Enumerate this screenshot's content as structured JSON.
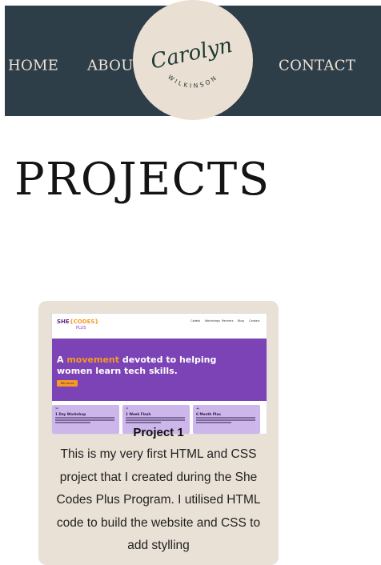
{
  "nav": {
    "items": [
      {
        "label": "HOME"
      },
      {
        "label": "ABOUT"
      },
      {
        "label": "CONTACT"
      }
    ]
  },
  "logo": {
    "script": "Carolyn",
    "surname": "WILKINSON"
  },
  "page_title": "PROJECTS",
  "project_card": {
    "title": "Project 1",
    "description": "This is my very first HTML and CSS project that I created during the She Codes Plus Program. I utilised HTML code to build the website and CSS to add stylling",
    "thumbnail": {
      "brand_she": "SHE",
      "brand_codes": "{CODES}",
      "brand_plus": "PLUS",
      "nav": [
        "Cadets",
        "Workshops",
        "Partners",
        "Blog",
        "Contact"
      ],
      "hero_prefix": "A ",
      "hero_highlight": "movement",
      "hero_suffix": " devoted to helping women learn tech skills.",
      "hero_button": "We count",
      "tiles": [
        {
          "icon": "✂",
          "title": "1 Day Workshop"
        },
        {
          "icon": "⚡",
          "title": "1 Week Flash"
        },
        {
          "icon": "+",
          "title": "6 Month Plus"
        }
      ]
    }
  },
  "colors": {
    "nav_bg": "#2e3e48",
    "nav_text": "#efe3d8",
    "logo_bg": "#eadfd3",
    "card_bg": "#e9e0d6",
    "thumb_purple": "#7b43b6",
    "thumb_orange": "#f59a23"
  }
}
